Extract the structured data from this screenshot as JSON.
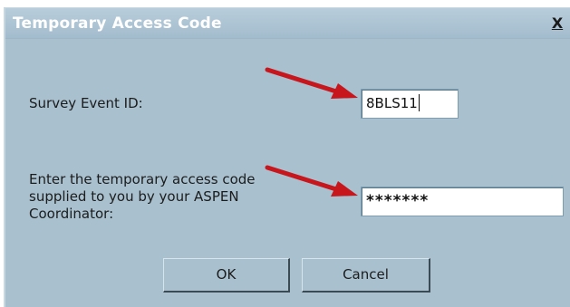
{
  "dialog": {
    "title": "Temporary Access Code",
    "close_label": "X"
  },
  "form": {
    "survey_label": "Survey Event ID:",
    "survey_value": "8BLS11",
    "code_label_lines": [
      "Enter the temporary access code",
      "supplied to you by your ASPEN",
      "Coordinator:"
    ],
    "code_value": "*******"
  },
  "buttons": {
    "ok_label": "OK",
    "cancel_label": "Cancel"
  },
  "colors": {
    "dialog_background": "#a9c0cf",
    "title_text": "#ffffff",
    "annotation_arrow": "#c8161d"
  },
  "icons": {
    "close": "close-icon",
    "annotation_arrows": "red-arrow-icon"
  }
}
